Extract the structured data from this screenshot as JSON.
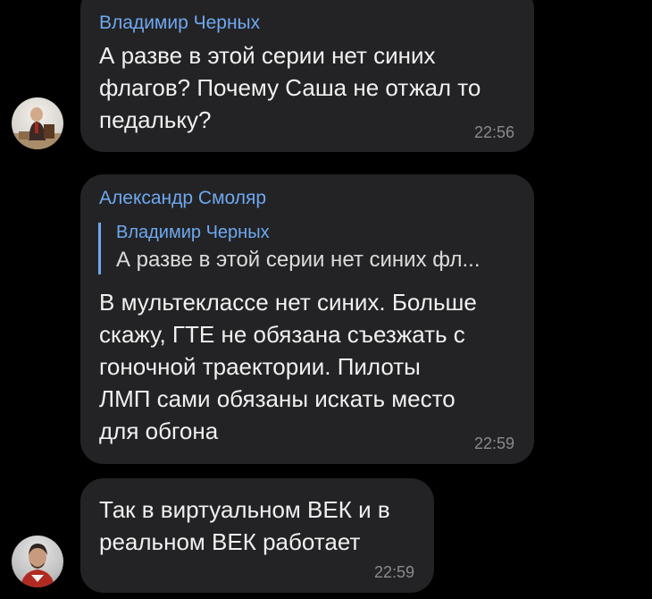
{
  "messages": [
    {
      "sender": "Владимир Черных",
      "text": "А разве в этой серии нет синих\nфлагов? Почему Саша не отжал то\nпедальку?",
      "time": "22:56"
    },
    {
      "sender": "Александр Смоляр",
      "reply": {
        "sender": "Владимир Черных",
        "text": "А разве в этой серии нет синих фл..."
      },
      "text": "В мультеклассе нет синих. Больше\nскажу, ГТЕ не обязана съезжать с\nгоночной траектории. Пилоты\nЛМП сами обязаны искать место\nдля обгона",
      "time": "22:59"
    },
    {
      "text": "Так в виртуальном ВЕК и в\nреальном ВЕК работает",
      "time": "22:59"
    }
  ],
  "colors": {
    "background": "#000000",
    "bubble": "#232325",
    "sender_name": "#6ea8f0",
    "time": "#8a8a8e"
  }
}
